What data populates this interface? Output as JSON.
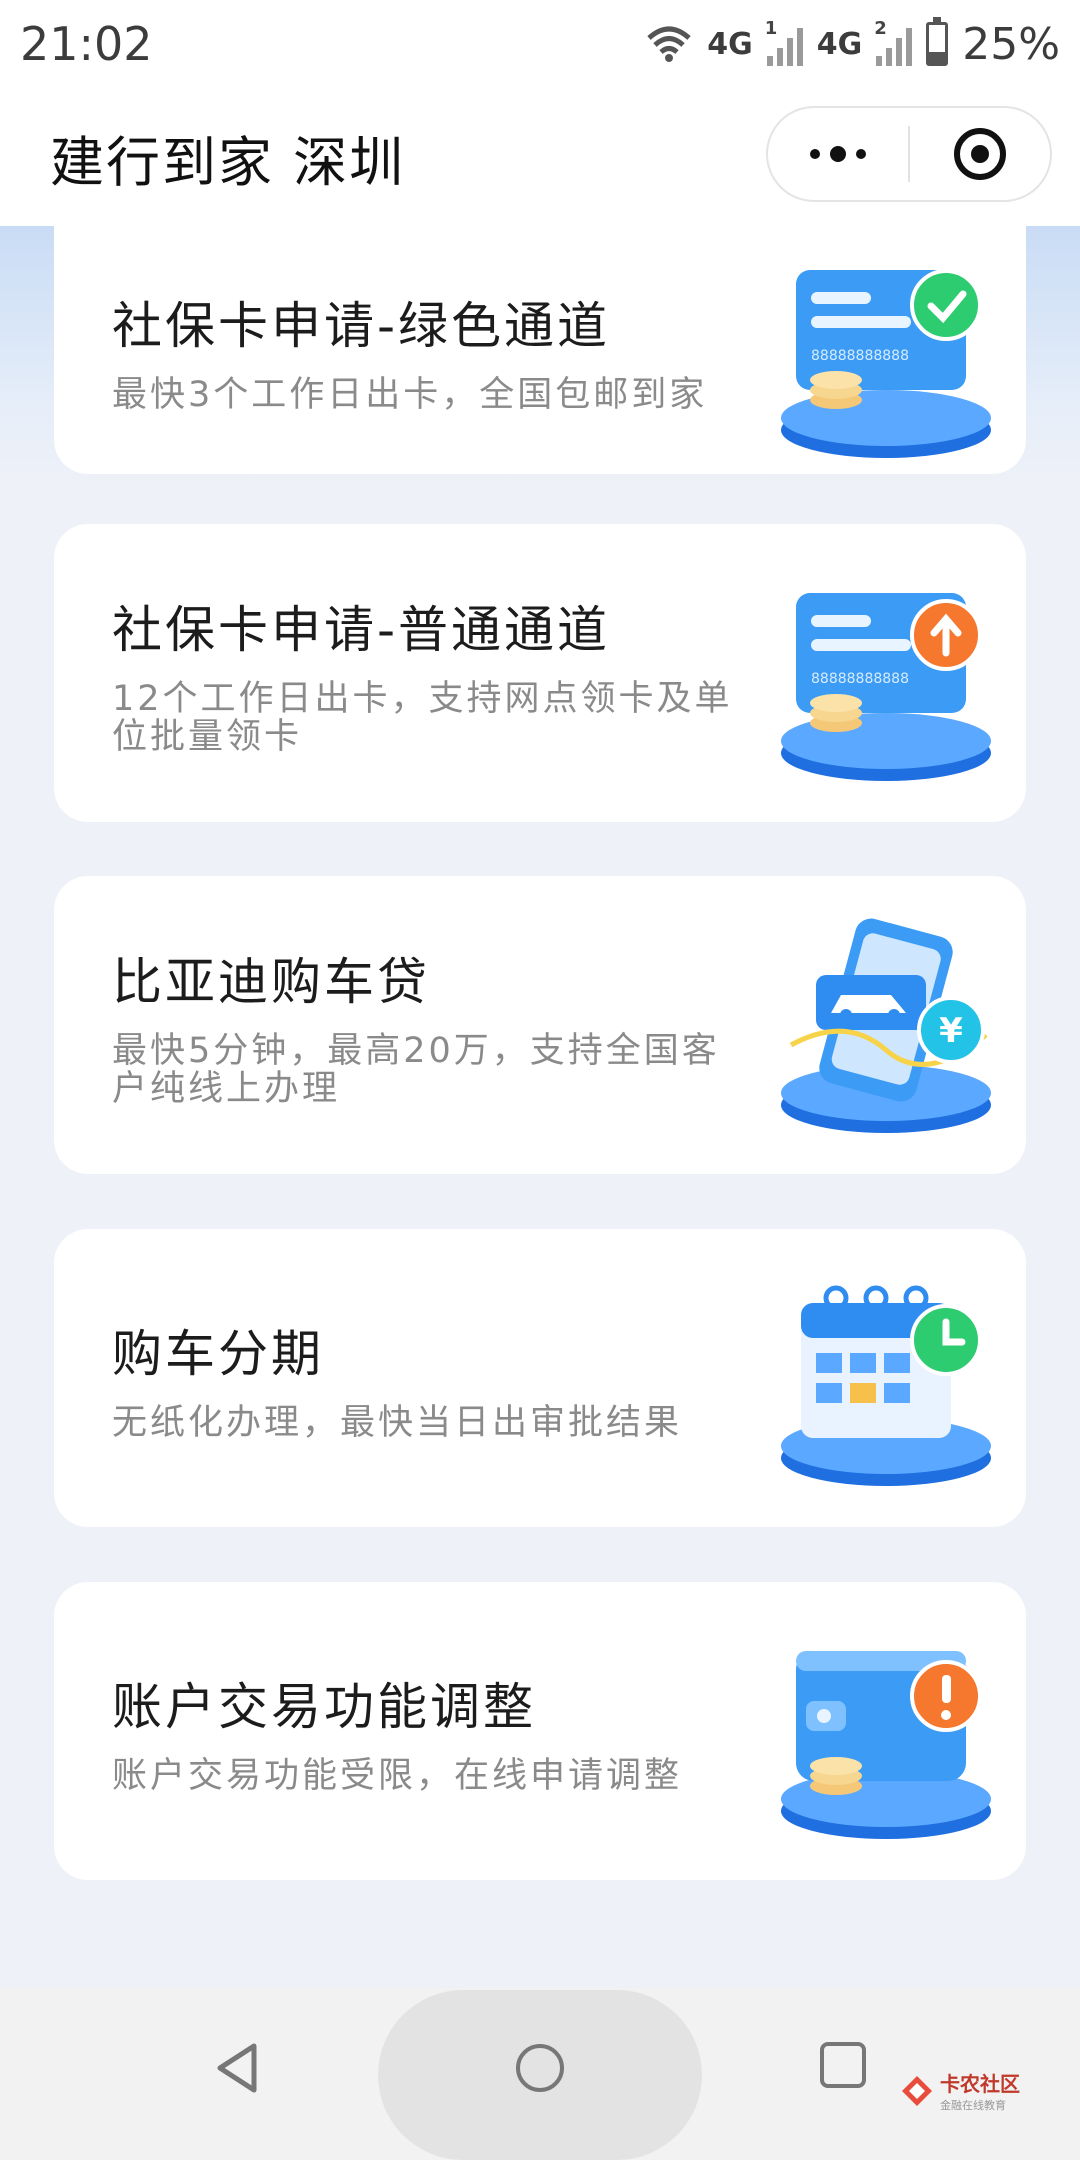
{
  "status_bar": {
    "time": "21:02",
    "network1": "4G",
    "network2": "4G",
    "sim1": "1",
    "sim2": "2",
    "battery": "25%",
    "icons": [
      "wifi-icon",
      "signal-icon",
      "signal-icon",
      "battery-icon"
    ]
  },
  "header": {
    "title": "建行到家 深圳",
    "more_icon": "more-dots-icon",
    "close_icon": "target-circle-icon"
  },
  "cards": [
    {
      "title": "社保卡申请-绿色通道",
      "desc": "最快3个工作日出卡，全国包邮到家",
      "icon": "card-check-icon"
    },
    {
      "title": "社保卡申请-普通通道",
      "desc": "12个工作日出卡，支持网点领卡及单位批量领卡",
      "icon": "card-upload-icon"
    },
    {
      "title": "比亚迪购车贷",
      "desc": "最快5分钟，最高20万，支持全国客户纯线上办理",
      "icon": "car-loan-icon"
    },
    {
      "title": "购车分期",
      "desc": "无纸化办理，最快当日出审批结果",
      "icon": "calendar-clock-icon"
    },
    {
      "title": "账户交易功能调整",
      "desc": "账户交易功能受限，在线申请调整",
      "icon": "wallet-alert-icon"
    }
  ],
  "card_art": {
    "card_number": "88888888888"
  },
  "watermark": {
    "title": "卡农社区",
    "subtitle": "金融在线教育"
  },
  "colors": {
    "accent_blue": "#2f8cf0",
    "green_badge": "#2ecc71",
    "orange_badge": "#f5782e",
    "cyan_badge": "#22c3e6"
  }
}
